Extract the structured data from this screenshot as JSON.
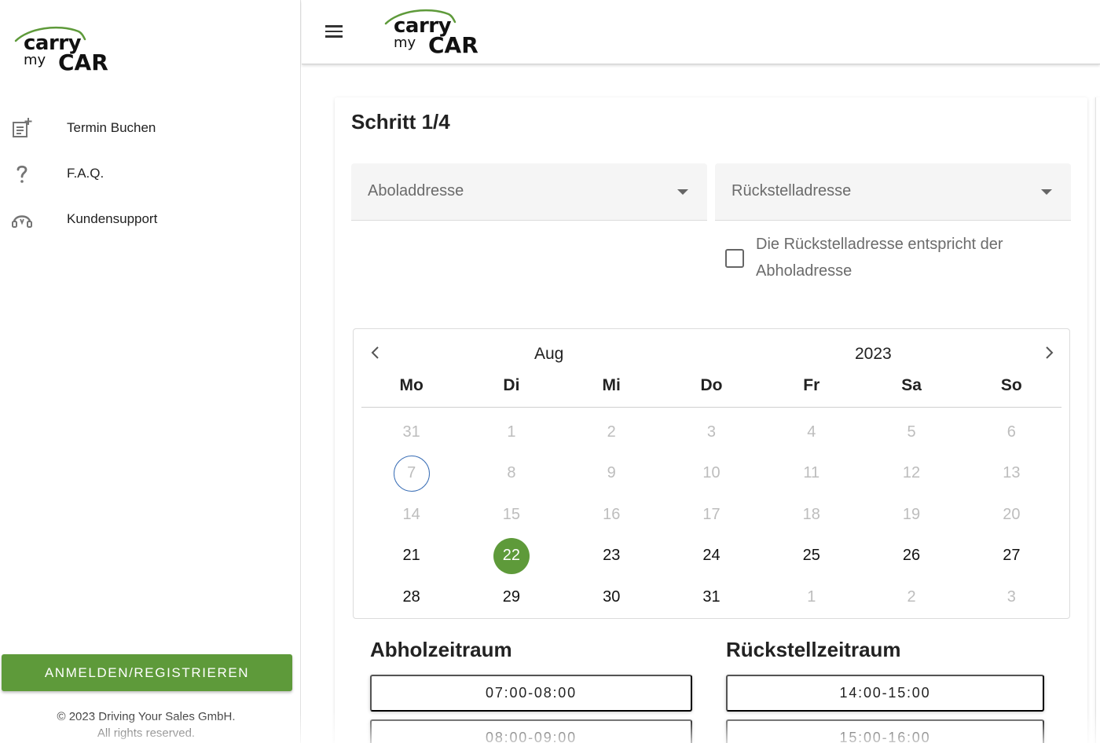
{
  "brand": {
    "line1": "carry",
    "line2a": "my",
    "line2b": "CAR",
    "green": "#5e9a3a"
  },
  "sidebar": {
    "items": [
      {
        "label": "Termin Buchen",
        "icon": "calendar-add-icon"
      },
      {
        "label": "F.A.Q.",
        "icon": "question-mark-icon"
      },
      {
        "label": "Kundensupport",
        "icon": "headset-icon"
      }
    ],
    "login_label": "ANMELDEN/REGISTRIEREN",
    "copyright_line1": "© 2023 Driving Your Sales GmbH.",
    "copyright_line2": "All rights reserved."
  },
  "main": {
    "step": "Schritt 1/4",
    "pickup_select": {
      "placeholder": "Aboladdresse"
    },
    "return_select": {
      "placeholder": "Rückstelladresse"
    },
    "same_address_checkbox": {
      "label": "Die Rückstelladresse entspricht der Abholadresse",
      "checked": false
    },
    "calendar": {
      "month": "Aug",
      "year": "2023",
      "weekdays": [
        "Mo",
        "Di",
        "Mi",
        "Do",
        "Fr",
        "Sa",
        "So"
      ],
      "weeks": [
        [
          {
            "d": "31",
            "s": "disabled"
          },
          {
            "d": "1",
            "s": "disabled"
          },
          {
            "d": "2",
            "s": "disabled"
          },
          {
            "d": "3",
            "s": "disabled"
          },
          {
            "d": "4",
            "s": "disabled"
          },
          {
            "d": "5",
            "s": "disabled"
          },
          {
            "d": "6",
            "s": "disabled"
          }
        ],
        [
          {
            "d": "7",
            "s": "today"
          },
          {
            "d": "8",
            "s": "disabled"
          },
          {
            "d": "9",
            "s": "disabled"
          },
          {
            "d": "10",
            "s": "disabled"
          },
          {
            "d": "11",
            "s": "disabled"
          },
          {
            "d": "12",
            "s": "disabled"
          },
          {
            "d": "13",
            "s": "disabled"
          }
        ],
        [
          {
            "d": "14",
            "s": "disabled"
          },
          {
            "d": "15",
            "s": "disabled"
          },
          {
            "d": "16",
            "s": "disabled"
          },
          {
            "d": "17",
            "s": "disabled"
          },
          {
            "d": "18",
            "s": "disabled"
          },
          {
            "d": "19",
            "s": "disabled"
          },
          {
            "d": "20",
            "s": "disabled"
          }
        ],
        [
          {
            "d": "21",
            "s": "active"
          },
          {
            "d": "22",
            "s": "selected"
          },
          {
            "d": "23",
            "s": "active"
          },
          {
            "d": "24",
            "s": "active"
          },
          {
            "d": "25",
            "s": "active"
          },
          {
            "d": "26",
            "s": "active"
          },
          {
            "d": "27",
            "s": "active"
          }
        ],
        [
          {
            "d": "28",
            "s": "active"
          },
          {
            "d": "29",
            "s": "active"
          },
          {
            "d": "30",
            "s": "active"
          },
          {
            "d": "31",
            "s": "active"
          },
          {
            "d": "1",
            "s": "disabled"
          },
          {
            "d": "2",
            "s": "disabled"
          },
          {
            "d": "3",
            "s": "disabled"
          }
        ]
      ]
    },
    "pickup_window": {
      "title": "Abholzeitraum",
      "slots": [
        "07:00-08:00",
        "08:00-09:00"
      ]
    },
    "return_window": {
      "title": "Rückstellzeitraum",
      "slots": [
        "14:00-15:00",
        "15:00-16:00"
      ]
    }
  }
}
